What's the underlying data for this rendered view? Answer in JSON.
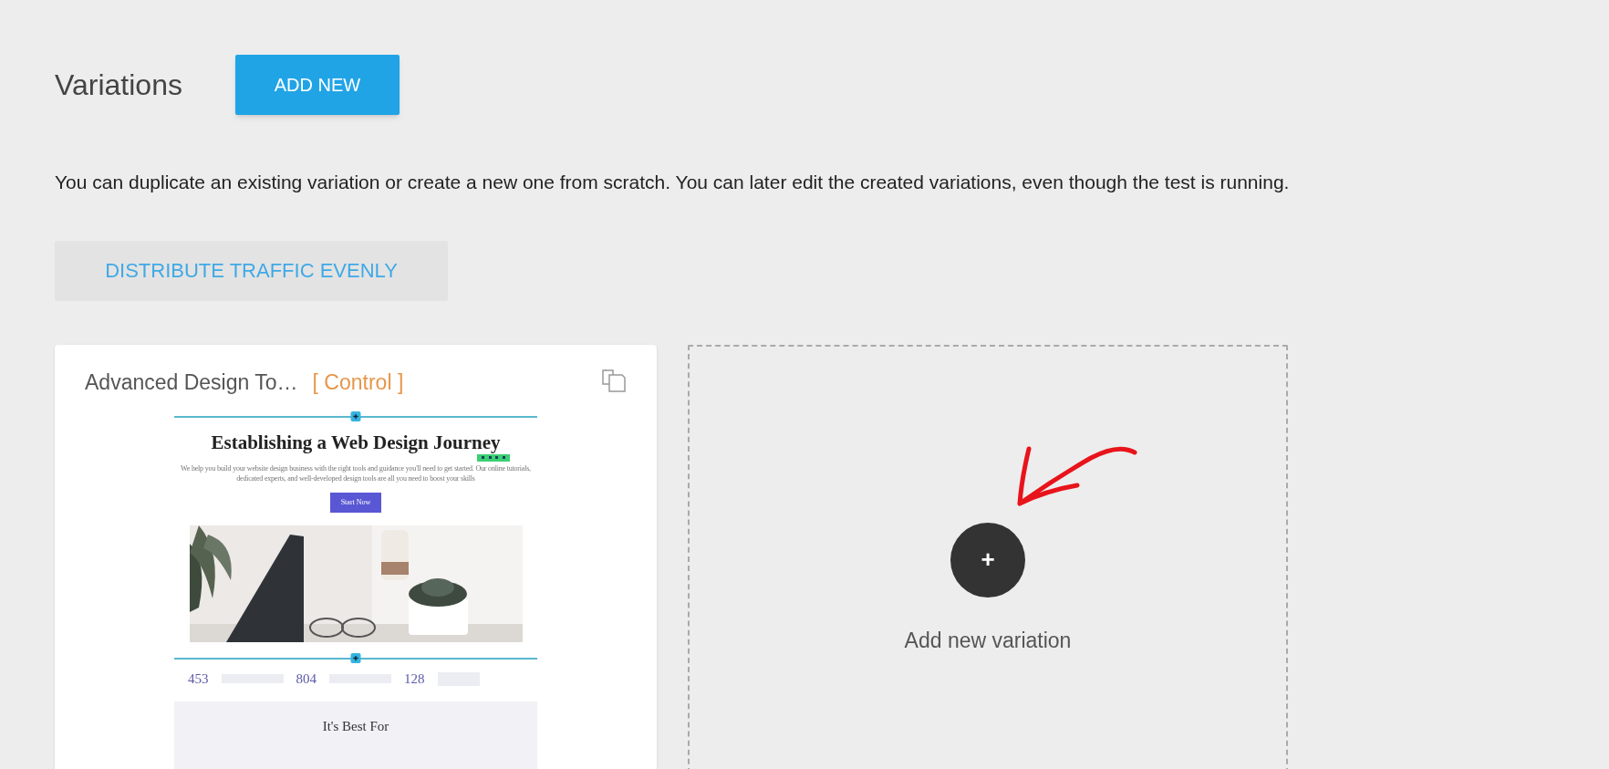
{
  "header": {
    "title": "Variations",
    "add_button": "ADD NEW"
  },
  "description": "You can duplicate an existing variation or create a new one from scratch. You can later edit the created variations, even though the test is running.",
  "distribute_button": "DISTRIBUTE TRAFFIC EVENLY",
  "variations": [
    {
      "name": "Advanced Design To…",
      "badge": "[ Control ]",
      "preview": {
        "heading": "Establishing a Web Design Journey",
        "text": "We help you build your website design business with the right tools and guidance you'll need to get started. Our online tutorials, dedicated experts, and well-developed design tools are all you need to boost your skills",
        "button": "Start Now",
        "stats": [
          "453",
          "804",
          "128"
        ],
        "section_title": "It's Best For"
      }
    }
  ],
  "add_card": {
    "label": "Add new variation",
    "plus": "+"
  }
}
